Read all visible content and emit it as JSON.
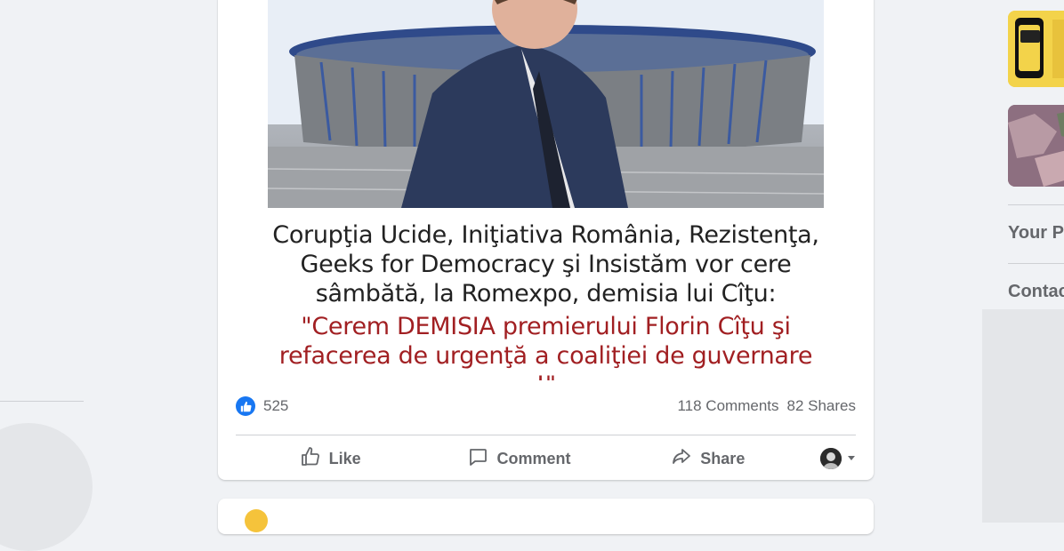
{
  "post": {
    "caption_lines": [
      "Corupţia Ucide, Iniţiativa România, Rezistenţa,",
      "Geeks for Democracy şi Insistăm vor cere",
      "sâmbătă, la Romexpo, demisia lui Cîţu:"
    ],
    "quote_lines": [
      "\"Cerem DEMISIA premierului Florin Cîţu şi",
      "refacerea de urgenţă a coaliţiei de guvernare !\""
    ],
    "reactions_count": "525",
    "comments": "118 Comments",
    "shares": "82 Shares",
    "actions": {
      "like": "Like",
      "comment": "Comment",
      "share": "Share"
    }
  },
  "sidebar_right": {
    "your_pages": "Your P",
    "contacts": "Contac"
  },
  "colors": {
    "brand_blue": "#1877f2",
    "quote_red": "#a11f22",
    "secondary_text": "#65676b",
    "page_bg": "#f0f2f5"
  }
}
